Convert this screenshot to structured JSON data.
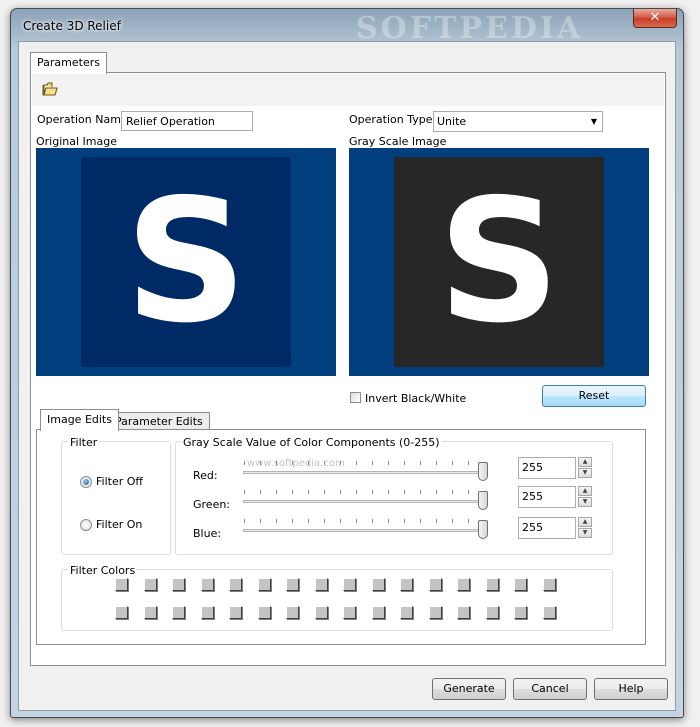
{
  "window": {
    "title": "Create 3D Relief",
    "watermark": "SOFTPEDIA",
    "close_glyph": "✕"
  },
  "tabs": {
    "parameters": "Parameters"
  },
  "toolbar": {
    "open_icon": "folder-open-icon"
  },
  "operation": {
    "name_label": "Operation Name:",
    "name_value": "Relief Operation",
    "type_label": "Operation Type:",
    "type_value": "Unite"
  },
  "original": {
    "label": "Original Image",
    "glyph": "S",
    "bg": "#003e7e",
    "inner_bg": "#002a66"
  },
  "grayscale": {
    "label": "Gray Scale Image",
    "glyph": "S",
    "bg": "#003e7e",
    "inner_bg": "#272727"
  },
  "invert_label": "Invert Black/White",
  "reset_label": "Reset",
  "subtabs": {
    "image_edits": "Image Edits",
    "parameter_edits": "Parameter Edits"
  },
  "filter": {
    "group_title": "Filter",
    "off_label": "Filter Off",
    "on_label": "Filter On",
    "selected": "Filter Off"
  },
  "grayscale_components": {
    "group_title": "Gray Scale Value of Color Components (0-255)",
    "watermark": "www.softpedia.com",
    "red_label": "Red:",
    "green_label": "Green:",
    "blue_label": "Blue:",
    "red_value": "255",
    "green_value": "255",
    "blue_value": "255",
    "max": 255
  },
  "filter_colors": {
    "group_title": "Filter Colors",
    "rows": 2,
    "cols": 16
  },
  "buttons": {
    "generate": "Generate",
    "cancel": "Cancel",
    "help": "Help"
  }
}
